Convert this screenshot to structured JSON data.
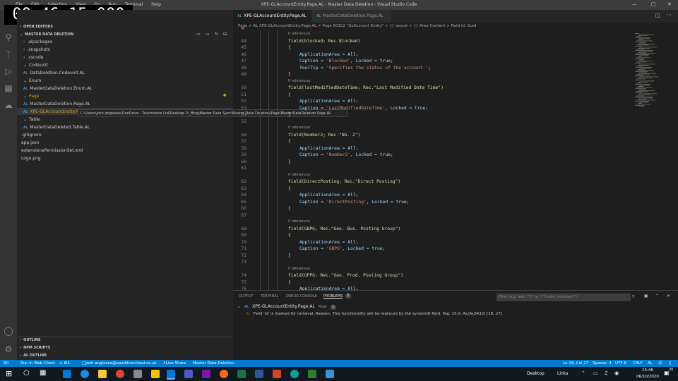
{
  "timer": "00:46:15.000",
  "window": {
    "menu": [
      "File",
      "Edit",
      "Selection",
      "View",
      "Go",
      "Run",
      "Terminal",
      "Help"
    ],
    "title": "XPE-GLAccountEntity.Page.AL - Master Data Deletion - Visual Studio Code"
  },
  "sidebar": {
    "open_editors": "OPEN EDITORS",
    "project": "MASTER DATA DELETION",
    "tree": [
      {
        "label": ".alpackages",
        "type": "folder"
      },
      {
        "label": ".snapshots",
        "type": "folder"
      },
      {
        "label": ".vscode",
        "type": "folder"
      },
      {
        "label": "Codeunit",
        "type": "folder-open"
      },
      {
        "label": "DataDeletion.Codeunit.AL",
        "type": "file"
      },
      {
        "label": "Enum",
        "type": "folder-open"
      },
      {
        "label": "MasterDataDeletion.Enum.AL",
        "type": "file"
      },
      {
        "label": "Page",
        "type": "folder-open"
      },
      {
        "label": "MasterDataDeletion.Page.AL",
        "type": "file"
      },
      {
        "label": "XPE-GLAccountEntity.Page.AL",
        "type": "file"
      },
      {
        "label": "Table",
        "type": "folder-open"
      },
      {
        "label": "MasterDataDeleted.Table.AL",
        "type": "file"
      },
      {
        "label": ".gitignore",
        "type": "plain"
      },
      {
        "label": "app.json",
        "type": "plain"
      },
      {
        "label": "extensionsPermissionSet.xml",
        "type": "plain"
      },
      {
        "label": "Logo.png",
        "type": "plain"
      }
    ],
    "tooltip": "C:\\Users\\josh.anglesea\\OneDrive - Touchstone Ltd\\Desktop 2\\_Blog\\Master Data Sync\\Master Data Deletion\\Page\\MasterDataDeletion.Page.AL",
    "outline": "OUTLINE",
    "npm": "NPM SCRIPTS",
    "al_outline": "AL OUTLINE",
    "al_badge": "AL"
  },
  "tabs": [
    {
      "label": "XPE-GLAccountEntity.Page.AL",
      "active": true
    },
    {
      "label": "MasterDataDeletion.Page.AL",
      "active": false
    }
  ],
  "breadcrumb": "Page  >  AL  XPE-GLAccountEntity.Page.AL  >  Page 50102 \"GLAccount Entity\"  >  {} layout  >  {} Area Content  >  Field id: Guid",
  "editor": {
    "lines": [
      {
        "n": "",
        "ref": "0 references"
      },
      {
        "n": "44",
        "t": "field(blocked; Rec.Blocked)",
        "ind": 0
      },
      {
        "n": "45",
        "t": "{",
        "ind": 0
      },
      {
        "n": "46",
        "t": "ApplicationArea = All;",
        "ind": 1
      },
      {
        "n": "47",
        "t": "Caption = 'Blocked', Locked = true;",
        "ind": 1
      },
      {
        "n": "48",
        "t": "ToolTip = 'Specifies the status of the account.';",
        "ind": 1
      },
      {
        "n": "49",
        "t": "}",
        "ind": 0
      },
      {
        "n": "",
        "ref": "0 references"
      },
      {
        "n": "50",
        "t": "field(lastModifiedDateTime; Rec.\"Last Modified Date Time\")",
        "ind": 0
      },
      {
        "n": "51",
        "t": "{",
        "ind": 0
      },
      {
        "n": "52",
        "t": "ApplicationArea = All;",
        "ind": 1
      },
      {
        "n": "53",
        "t": "Caption = 'LastModifiedDateTime', Locked = true;",
        "ind": 1
      },
      {
        "n": "54",
        "t": "}",
        "ind": 0
      },
      {
        "n": "55",
        "t": "",
        "ind": 0
      },
      {
        "n": "",
        "ref": "0 references"
      },
      {
        "n": "56",
        "t": "field(Number2; Rec.\"No. 2\")",
        "ind": 0
      },
      {
        "n": "57",
        "t": "{",
        "ind": 0
      },
      {
        "n": "58",
        "t": "ApplicationArea = All;",
        "ind": 1
      },
      {
        "n": "59",
        "t": "Caption = 'Number2', Locked = true;",
        "ind": 1
      },
      {
        "n": "60",
        "t": "}",
        "ind": 0
      },
      {
        "n": "61",
        "t": "",
        "ind": 0
      },
      {
        "n": "",
        "ref": "0 references"
      },
      {
        "n": "62",
        "t": "field(DirectPosting; Rec.\"Direct Posting\")",
        "ind": 0
      },
      {
        "n": "63",
        "t": "{",
        "ind": 0
      },
      {
        "n": "64",
        "t": "ApplicationArea = All;",
        "ind": 1
      },
      {
        "n": "65",
        "t": "Caption = 'DirectPosting', Locked = true;",
        "ind": 1
      },
      {
        "n": "66",
        "t": "}",
        "ind": 0
      },
      {
        "n": "67",
        "t": "",
        "ind": 0
      },
      {
        "n": "",
        "ref": "0 references"
      },
      {
        "n": "68",
        "t": "field(GBPG; Rec.\"Gen. Bus. Posting Group\")",
        "ind": 0
      },
      {
        "n": "69",
        "t": "{",
        "ind": 0
      },
      {
        "n": "70",
        "t": "ApplicationArea = All;",
        "ind": 1
      },
      {
        "n": "71",
        "t": "Caption = 'GBPG', Locked = true;",
        "ind": 1
      },
      {
        "n": "72",
        "t": "}",
        "ind": 0
      },
      {
        "n": "73",
        "t": "",
        "ind": 0
      },
      {
        "n": "",
        "ref": "0 references"
      },
      {
        "n": "74",
        "t": "field(GPPG; Rec.\"Gen. Prod. Posting Group\")",
        "ind": 0
      },
      {
        "n": "75",
        "t": "{",
        "ind": 0
      },
      {
        "n": "76",
        "t": "ApplicationArea = All;",
        "ind": 1
      }
    ]
  },
  "panel": {
    "tabs": [
      "OUTPUT",
      "TERMINAL",
      "DEBUG CONSOLE",
      "PROBLEMS"
    ],
    "problems_count": "1",
    "filter_placeholder": "Filter (e.g. text, **/*.ts, !**/node_modules/**)",
    "file": "XPE-GLAccountEntity.Page.AL",
    "file_folder": "Page",
    "file_count": "1",
    "message": "Field 'id' is marked for removal. Reason: This functionality will be replaced by the systemID field. Tag: 15.0.  AL(AL0432)  [18, 27]"
  },
  "statusbar": {
    "git": "0",
    "run_web": "Run In Web Client",
    "errors": "0",
    "warnings": "1",
    "account": "josh.anglesea@xpeditioncloud.co.uk",
    "live_share": "Live Share",
    "project": "Master Data Deletion",
    "position": "Ln 18, Col 27",
    "spaces": "Spaces: 4",
    "encoding": "UTF-8",
    "eol": "CRLF",
    "lang": "AL"
  },
  "taskbar": {
    "desktop": "Desktop",
    "links": "Links",
    "time": "15:46",
    "date": "06/10/2020",
    "notif": "20"
  },
  "colors": {
    "accent": "#007acc",
    "warning": "#cca700",
    "string": "#ce9178"
  }
}
